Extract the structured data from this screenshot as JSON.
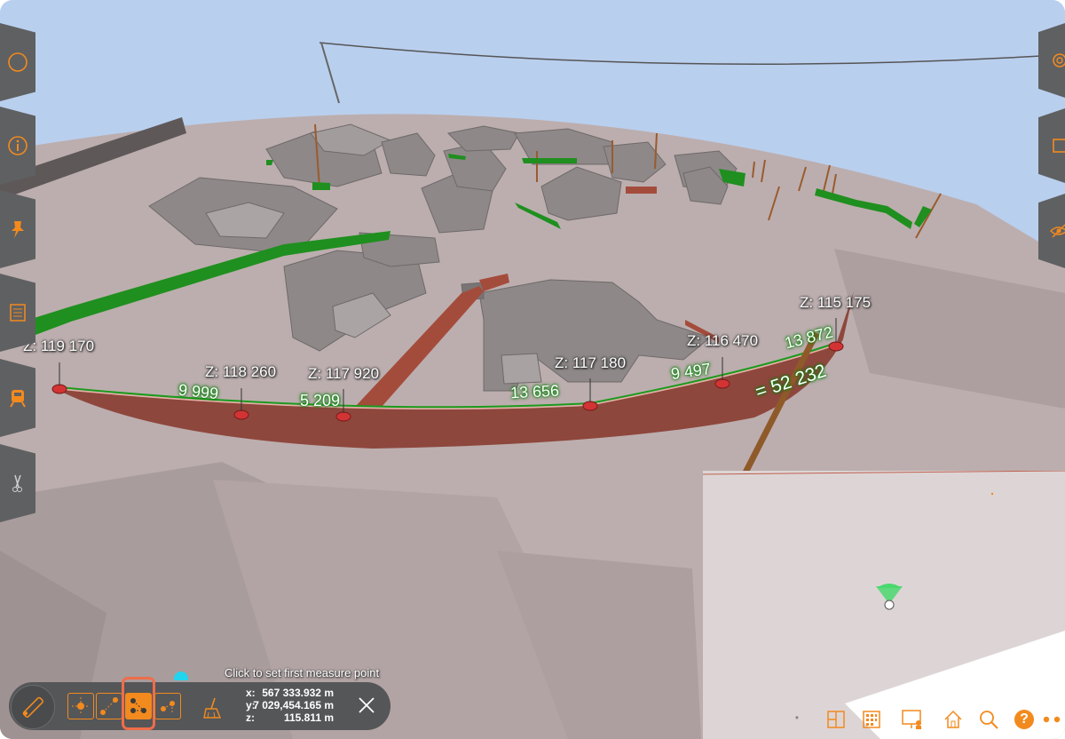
{
  "elevation_labels": [
    "Z: 119 170",
    "Z: 118 260",
    "Z: 117 920",
    "Z: 117 180",
    "Z: 116 470",
    "Z: 115 175"
  ],
  "segment_labels": [
    "9 999",
    "5 209",
    "13 656",
    "9 497",
    "13 872"
  ],
  "total_label": "= 52 232",
  "measure_hint": "Click to set first measure point",
  "coordinates": {
    "x_label": "x:",
    "x_value": "567 333.932 m",
    "y_label": "y:",
    "y_value": "7 029,454.165 m",
    "z_label": "z:",
    "z_value": "115.811 m"
  },
  "colors": {
    "sky": "#b9cfee",
    "terrain": "#bcaeae",
    "building": "#8e8888",
    "profile_fill": "#8e473d",
    "fence": "#1f8f1f",
    "accent": "#f28a1e",
    "panel": "#5f6062"
  },
  "left_tools": [
    "circle-icon",
    "info-icon",
    "pin-icon",
    "list-icon",
    "train-icon",
    "scissors-icon"
  ],
  "right_tools": [
    "settings-icon",
    "rectangle-icon",
    "eye-icon"
  ],
  "bottom_tools": [
    "floorplan-icon",
    "building-icon",
    "screen-person-icon",
    "home-icon",
    "search-icon",
    "help-icon",
    "more-icon"
  ],
  "help_symbol": "?",
  "minimap_marker": "*"
}
